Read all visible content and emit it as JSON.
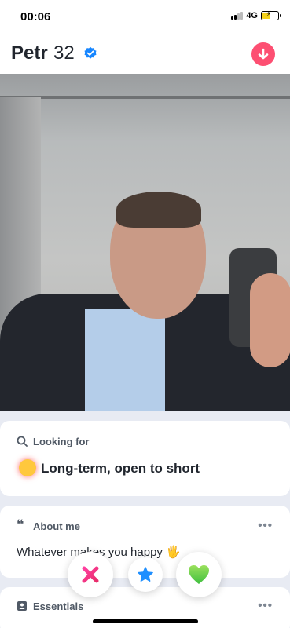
{
  "status_bar": {
    "time": "00:06",
    "network": "4G",
    "battery_level": 0.55
  },
  "profile": {
    "name": "Petr",
    "age": "32",
    "verified": true
  },
  "colors": {
    "accent": "#fd4f72",
    "verified": "#1786ff",
    "super_like": "#1e8fff",
    "nope": "#e82d6b",
    "like": "#6bd13a"
  },
  "icons": {
    "verified": "verified-badge-icon",
    "down": "arrow-down-icon",
    "search": "search-icon",
    "quote": "quote-icon",
    "essentials": "id-card-icon",
    "nope": "x-icon",
    "super_like": "star-icon",
    "like": "heart-icon"
  },
  "looking_for": {
    "label": "Looking for",
    "value": "Long-term, open to short",
    "emoji": "😍"
  },
  "about_me": {
    "label": "About me",
    "text": "Whatever makes you happy",
    "emoji": "🖐",
    "more": "•••"
  },
  "essentials": {
    "label": "Essentials",
    "more": "•••"
  }
}
